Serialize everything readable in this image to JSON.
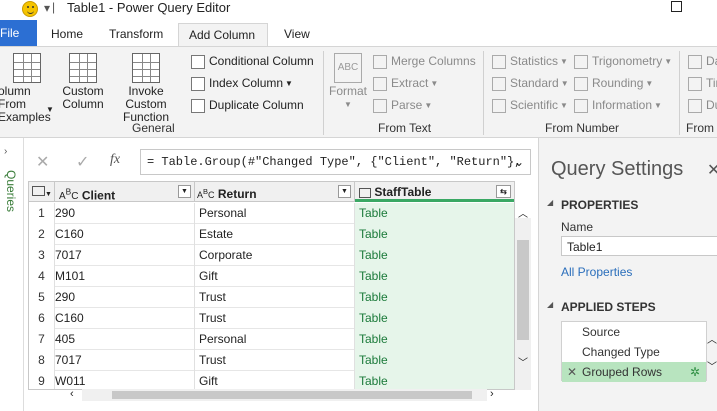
{
  "window": {
    "title": "Table1 - Power Query Editor",
    "qat_label": "▾"
  },
  "ribbon_tabs": [
    {
      "label": "File"
    },
    {
      "label": "Home"
    },
    {
      "label": "Transform"
    },
    {
      "label": "Add Column"
    },
    {
      "label": "View"
    }
  ],
  "general_group": {
    "column_from_examples": "olumn From\nExamples",
    "custom_column": "Custom\nColumn",
    "invoke_custom_function": "Invoke Custom\nFunction",
    "conditional_column": "Conditional Column",
    "index_column": "Index Column",
    "duplicate_column": "Duplicate Column",
    "label": "General"
  },
  "from_text_group": {
    "format": "Format",
    "merge_columns": "Merge Columns",
    "extract": "Extract",
    "parse": "Parse",
    "label": "From Text"
  },
  "from_number_group": {
    "statistics": "Statistics",
    "standard": "Standard",
    "scientific": "Scientific",
    "trigonometry": "Trigonometry",
    "rounding": "Rounding",
    "information": "Information",
    "label": "From Number"
  },
  "from_date_group": {
    "label": "From I",
    "d1": "Da",
    "d2": "Tir",
    "d3": "Du"
  },
  "formula_bar": {
    "fx": "fx",
    "expression": "= Table.Group(#\"Changed Type\", {\"Client\", \"Return\"},"
  },
  "queries_pane": {
    "label": "Queries"
  },
  "grid": {
    "columns": [
      {
        "name": "Client",
        "type_icon": "ABC"
      },
      {
        "name": "Return",
        "type_icon": "ABC"
      },
      {
        "name": "StaffTable",
        "type_icon": "table"
      }
    ],
    "rows": [
      {
        "n": "1",
        "client": "290",
        "ret": "Personal",
        "staff": "Table"
      },
      {
        "n": "2",
        "client": "C160",
        "ret": "Estate",
        "staff": "Table"
      },
      {
        "n": "3",
        "client": "7017",
        "ret": "Corporate",
        "staff": "Table"
      },
      {
        "n": "4",
        "client": "M101",
        "ret": "Gift",
        "staff": "Table"
      },
      {
        "n": "5",
        "client": "290",
        "ret": "Trust",
        "staff": "Table"
      },
      {
        "n": "6",
        "client": "C160",
        "ret": "Trust",
        "staff": "Table"
      },
      {
        "n": "7",
        "client": "405",
        "ret": "Personal",
        "staff": "Table"
      },
      {
        "n": "8",
        "client": "7017",
        "ret": "Trust",
        "staff": "Table"
      },
      {
        "n": "9",
        "client": "W011",
        "ret": "Gift",
        "staff": "Table"
      }
    ]
  },
  "query_settings": {
    "title": "Query Settings",
    "properties_heading": "PROPERTIES",
    "name_label": "Name",
    "name_value": "Table1",
    "all_properties": "All Properties",
    "applied_steps_heading": "APPLIED STEPS",
    "steps": [
      {
        "label": "Source"
      },
      {
        "label": "Changed Type"
      },
      {
        "label": "Grouped Rows"
      }
    ]
  },
  "colors": {
    "file_tab": "#2c6fd3",
    "accent_green": "#1b7a3a",
    "selected_step": "#b8e4bf",
    "link_blue": "#2a6ebb"
  }
}
